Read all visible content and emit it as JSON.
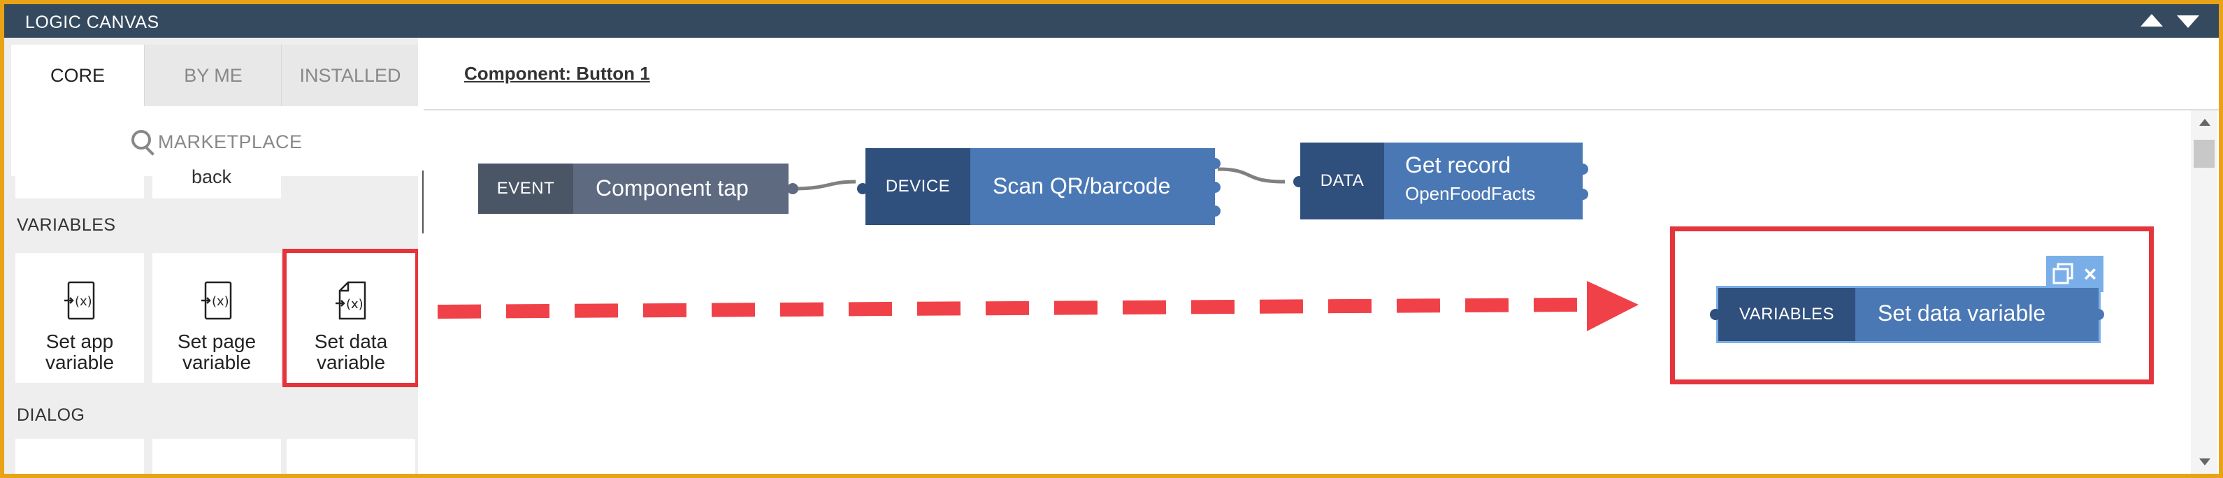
{
  "window": {
    "title": "LOGIC CANVAS"
  },
  "sidebar": {
    "tabs": [
      {
        "label": "CORE"
      },
      {
        "label": "BY ME"
      },
      {
        "label": "INSTALLED"
      }
    ],
    "search": {
      "label": "MARKETPLACE"
    },
    "partial_tile_label": "back",
    "sections": [
      {
        "title": "VARIABLES"
      },
      {
        "title": "DIALOG"
      }
    ],
    "variable_tiles": [
      {
        "line1": "Set app",
        "line2": "variable"
      },
      {
        "line1": "Set page",
        "line2": "variable"
      },
      {
        "line1": "Set data",
        "line2": "variable"
      }
    ]
  },
  "canvas": {
    "component_title": "Component: Button 1",
    "nodes": {
      "event": {
        "tag": "EVENT",
        "title": "Component tap"
      },
      "device": {
        "tag": "DEVICE",
        "title": "Scan QR/barcode"
      },
      "data": {
        "tag": "DATA",
        "title": "Get record",
        "subtitle": "OpenFoodFacts"
      },
      "variables": {
        "tag": "VARIABLES",
        "title": "Set data variable"
      }
    }
  },
  "colors": {
    "title_bar": "#354a5f",
    "event_tag": "#4a5566",
    "event_body": "#5d6a80",
    "node_tag": "#2f4f7c",
    "node_body": "#4a78b5",
    "highlight": "#e4353c",
    "frame": "#e8a317"
  }
}
